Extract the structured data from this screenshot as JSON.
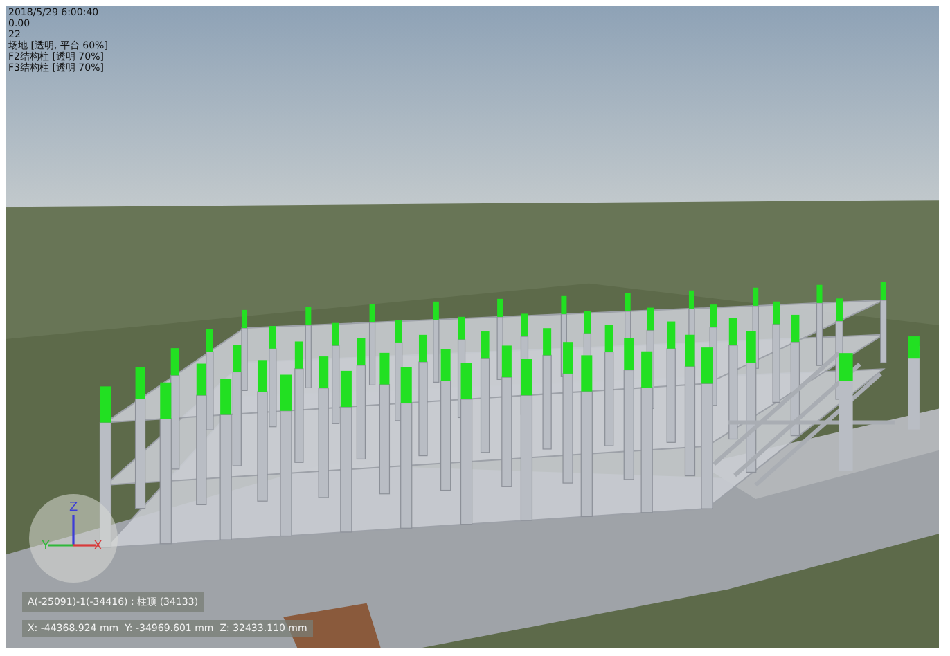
{
  "viewport": {
    "status_lines": [
      "2018/5/29 6:00:40",
      "0.00",
      "22",
      "场地 [透明, 平台 60%]",
      "F2结构柱 [透明 70%]",
      "F3结构柱 [透明 70%]"
    ]
  },
  "gizmo": {
    "axes": [
      {
        "label": "Z",
        "color": "#3c3cd8"
      },
      {
        "label": "Y",
        "color": "#2fb83a"
      },
      {
        "label": "X",
        "color": "#d83a3a"
      }
    ]
  },
  "info": {
    "element": "A(-25091)-1(-34416) : 柱顶 (34133)",
    "coordinates": "X: -44368.924 mm  Y: -34969.601 mm  Z: 32433.110 mm"
  }
}
